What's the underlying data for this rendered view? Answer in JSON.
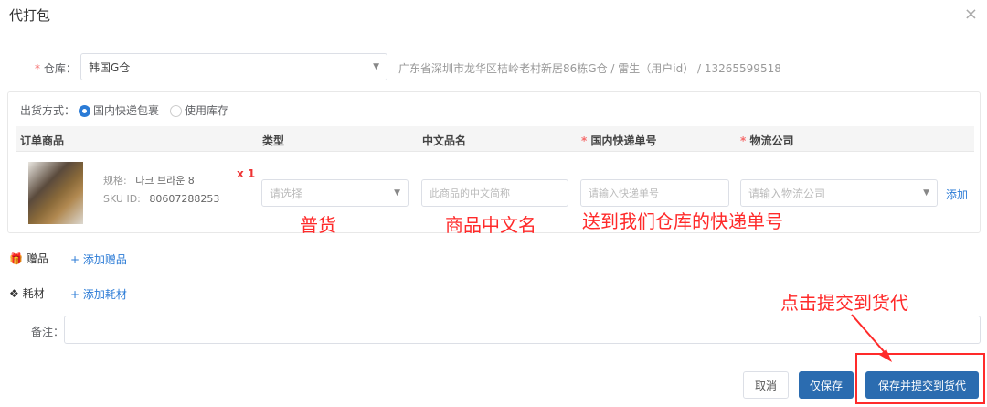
{
  "dialog": {
    "title": "代打包",
    "close": "×"
  },
  "warehouse": {
    "label": "仓库：",
    "value": "韩国G仓",
    "address": "广东省深圳市龙华区桔岭老村新居86栋G仓 / 雷生（用户id） / 13265599518"
  },
  "shipping": {
    "label": "出货方式：",
    "options": [
      {
        "label": "国内快递包裹",
        "selected": true
      },
      {
        "label": "使用库存",
        "selected": false
      }
    ]
  },
  "table": {
    "headers": [
      "订单商品",
      "类型",
      "中文品名",
      "国内快递单号",
      "物流公司"
    ],
    "row": {
      "spec_label": "规格:",
      "spec": "다크 브라운 8",
      "sku_label": "SKU ID:",
      "sku": "80607288253",
      "qty": "x 1",
      "type_placeholder": "请选择",
      "name_placeholder": "此商品的中文简称",
      "tracking_placeholder": "请输入快递单号",
      "carrier_placeholder": "请输入物流公司",
      "add": "添加"
    }
  },
  "annotations": {
    "type": "普货",
    "name": "商品中文名",
    "tracking": "送到我们仓库的快递单号",
    "submit": "点击提交到货代"
  },
  "gift": {
    "label": "赠品",
    "add": "+ 添加赠品"
  },
  "material": {
    "label": "耗材",
    "add": "+ 添加耗材"
  },
  "remark": {
    "label": "备注："
  },
  "footer": {
    "cancel": "取消",
    "save": "仅保存",
    "save_submit": "保存并提交到货代"
  },
  "colors": {
    "primary": "#2b6cb0",
    "annotation": "#ff2a2a"
  }
}
